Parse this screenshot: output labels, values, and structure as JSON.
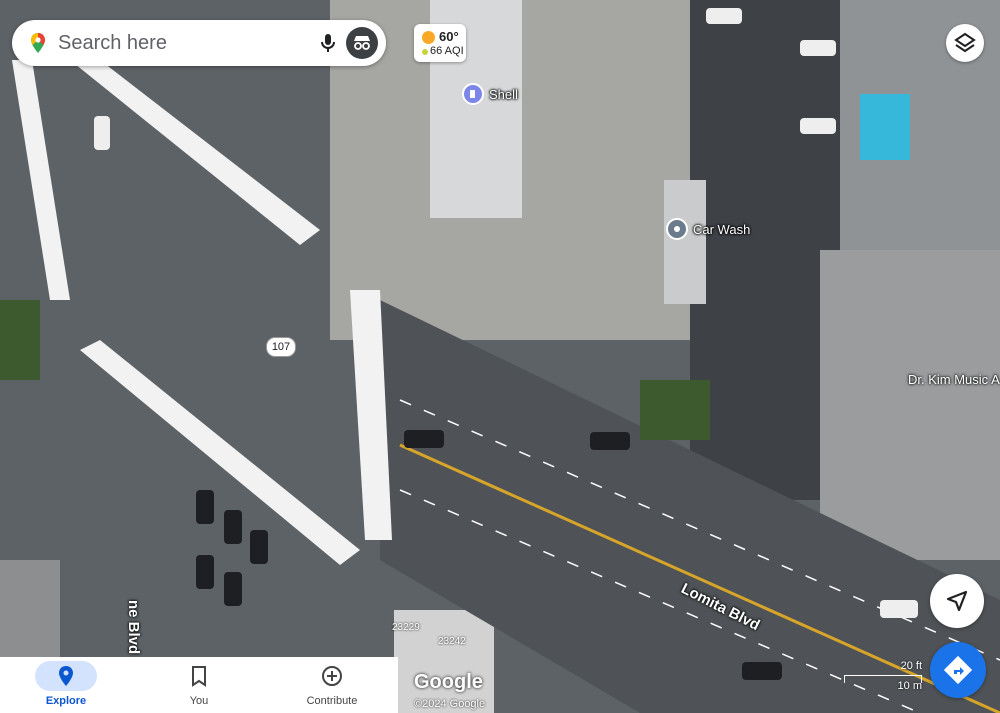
{
  "search": {
    "placeholder": "Search here"
  },
  "weather": {
    "temp": "60°",
    "aqi": "66 AQI"
  },
  "places": {
    "shell": "Shell",
    "car_wash": "Car Wash",
    "music": "Dr. Kim Music A"
  },
  "streets": {
    "lomita": "Lomita Blvd",
    "ne_blvd": "ne Blvd",
    "route": "107"
  },
  "addresses": {
    "a1": "23229",
    "a2": "23242"
  },
  "scale": {
    "feet": "20 ft",
    "meters": "10 m"
  },
  "attribution": {
    "brand": "Google",
    "copyright": "©2024 Google"
  },
  "nav": [
    {
      "label": "Explore",
      "icon": "pin-icon",
      "active": true
    },
    {
      "label": "You",
      "icon": "bookmark-icon",
      "active": false
    },
    {
      "label": "Contribute",
      "icon": "add-circle-icon",
      "active": false
    }
  ],
  "colors": {
    "accent": "#1a73e8",
    "nav_active": "#0b57d0"
  }
}
